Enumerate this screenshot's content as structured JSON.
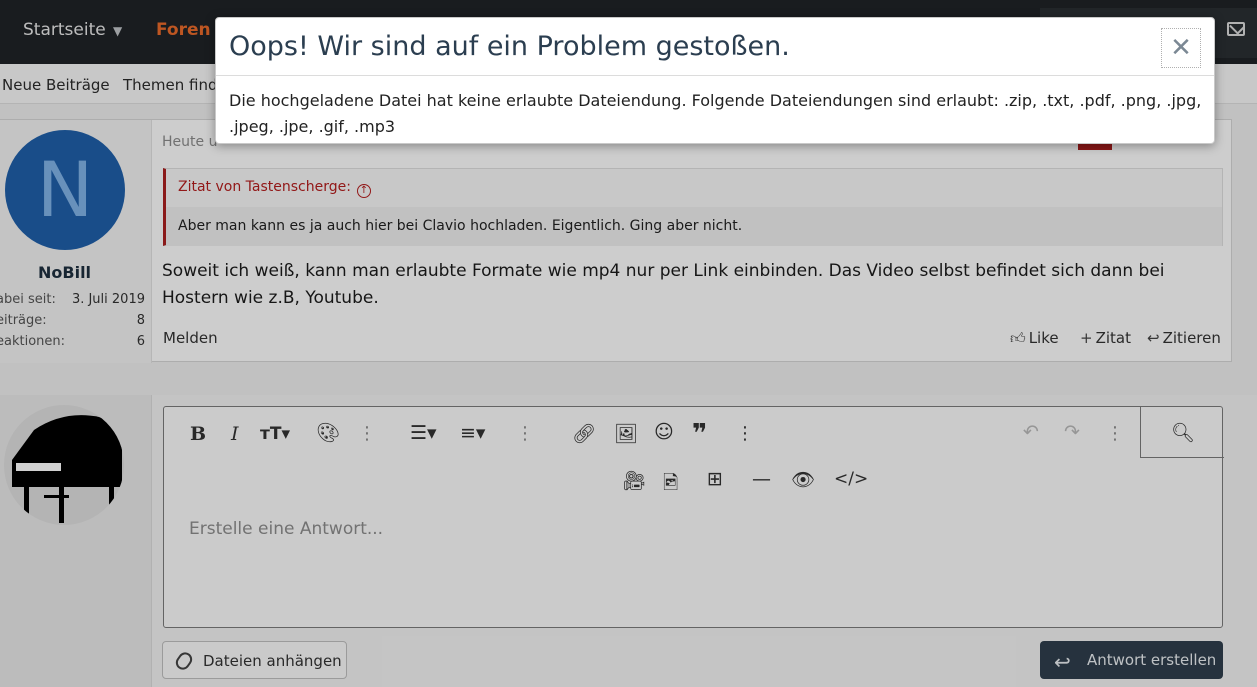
{
  "nav": {
    "home": "Startseite",
    "forums": "Foren"
  },
  "subnav": {
    "new_posts": "Neue Beiträge",
    "find_threads": "Themen finde"
  },
  "post": {
    "timestamp": "Heute u",
    "author": "NoBill",
    "avatar_letter": "N",
    "stats": [
      {
        "label": "abei seit:",
        "value": "3. Juli 2019"
      },
      {
        "label": "eiträge:",
        "value": "8"
      },
      {
        "label": "eaktionen:",
        "value": "6"
      }
    ],
    "quote_header": "Zitat von Tastenscherge:",
    "quote_text": "Aber man kann es ja auch hier bei Clavio hochladen. Eigentlich. Ging aber nicht.",
    "body": "Soweit ich weiß, kann man erlaubte Formate wie mp4 nur per Link einbinden. Das Video selbst befindet sich dann bei Hostern wie z.B, Youtube.",
    "report": "Melden",
    "like": "Like",
    "quote": "Zitat",
    "reply": "Zitieren"
  },
  "editor": {
    "placeholder": "Erstelle eine Antwort...",
    "attach": "Dateien anhängen",
    "submit": "Antwort erstellen",
    "toolbar_icons": [
      "bold-icon",
      "italic-icon",
      "text-size-icon",
      "palette-icon",
      "list-icon",
      "align-icon",
      "link-icon",
      "image-icon",
      "smilie-icon",
      "quote-icon",
      "undo-icon",
      "redo-icon",
      "preview-icon",
      "video-icon",
      "media-icon",
      "table-icon",
      "hr-icon",
      "spoiler-icon",
      "code-icon"
    ]
  },
  "modal": {
    "title": "Oops! Wir sind auf ein Problem gestoßen.",
    "message": "Die hochgeladene Datei hat keine erlaubte Dateiendung. Folgende Dateiendungen sind erlaubt: .zip, .txt, .pdf, .png, .jpg, .jpeg, .jpe, .gif, .mp3",
    "close": "✕"
  },
  "colors": {
    "nav_bg": "#1f2327",
    "nav_active": "#e86a2a",
    "quote_accent": "#b31e1e",
    "submit_bg": "#2f3e4c",
    "modal_title": "#2b3e50"
  }
}
